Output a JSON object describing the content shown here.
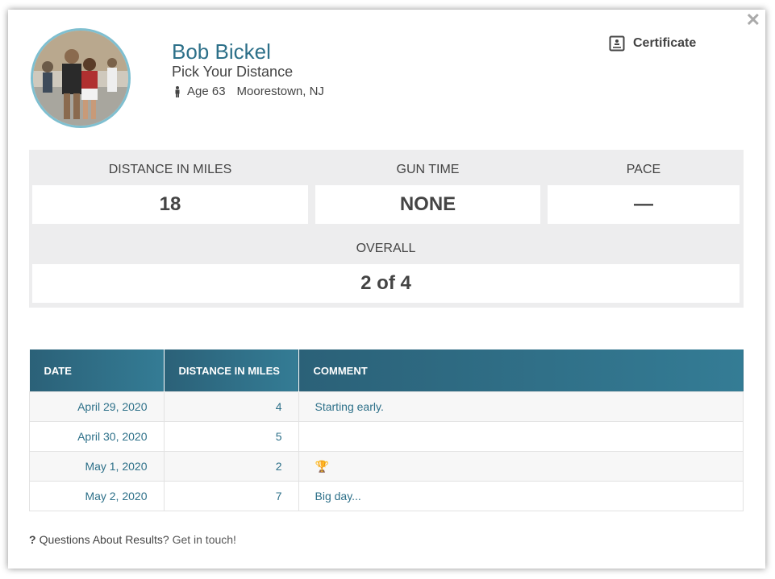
{
  "profile": {
    "name": "Bob Bickel",
    "event": "Pick Your Distance",
    "age": "Age 63",
    "location": "Moorestown, NJ"
  },
  "certificate_label": "Certificate",
  "stats": {
    "distance_label": "DISTANCE IN MILES",
    "distance_value": "18",
    "gun_time_label": "GUN TIME",
    "gun_time_value": "NONE",
    "pace_label": "PACE",
    "pace_value": "—",
    "overall_label": "OVERALL",
    "overall_value": "2 of 4"
  },
  "table": {
    "headers": [
      "DATE",
      "DISTANCE IN MILES",
      "COMMENT"
    ],
    "rows": [
      {
        "date": "April 29, 2020",
        "miles": "4",
        "comment": "Starting early."
      },
      {
        "date": "April 30, 2020",
        "miles": "5",
        "comment": ""
      },
      {
        "date": "May 1, 2020",
        "miles": "2",
        "comment": "🏆"
      },
      {
        "date": "May 2, 2020",
        "miles": "7",
        "comment": "Big day..."
      }
    ]
  },
  "footer": {
    "question_mark": "?",
    "question": "Questions About Results?",
    "link": "Get in touch!"
  },
  "colors": {
    "accent": "#2d7089",
    "header_bg": "#2b6178",
    "avatar_border": "#7fbfd0"
  },
  "icons": [
    "close-icon",
    "certificate-icon",
    "person-icon",
    "trophy-icon"
  ]
}
